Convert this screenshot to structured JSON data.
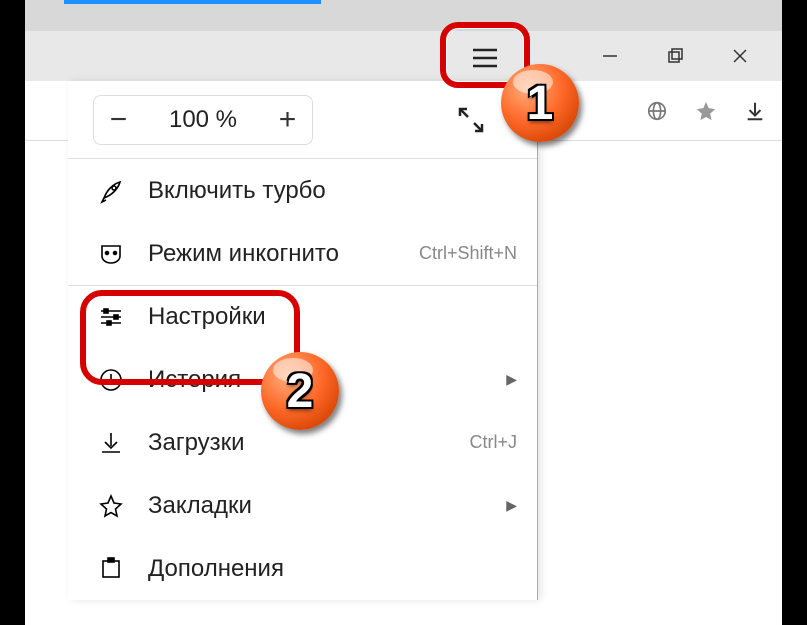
{
  "zoom": {
    "minus": "−",
    "value": "100 %",
    "plus": "+"
  },
  "menu": {
    "turbo": "Включить турбо",
    "incognito": "Режим инкогнито",
    "incognito_shortcut": "Ctrl+Shift+N",
    "settings": "Настройки",
    "history": "История",
    "downloads": "Загрузки",
    "downloads_shortcut": "Ctrl+J",
    "bookmarks": "Закладки",
    "addons": "Дополнения"
  },
  "badges": {
    "one": "1",
    "two": "2"
  }
}
